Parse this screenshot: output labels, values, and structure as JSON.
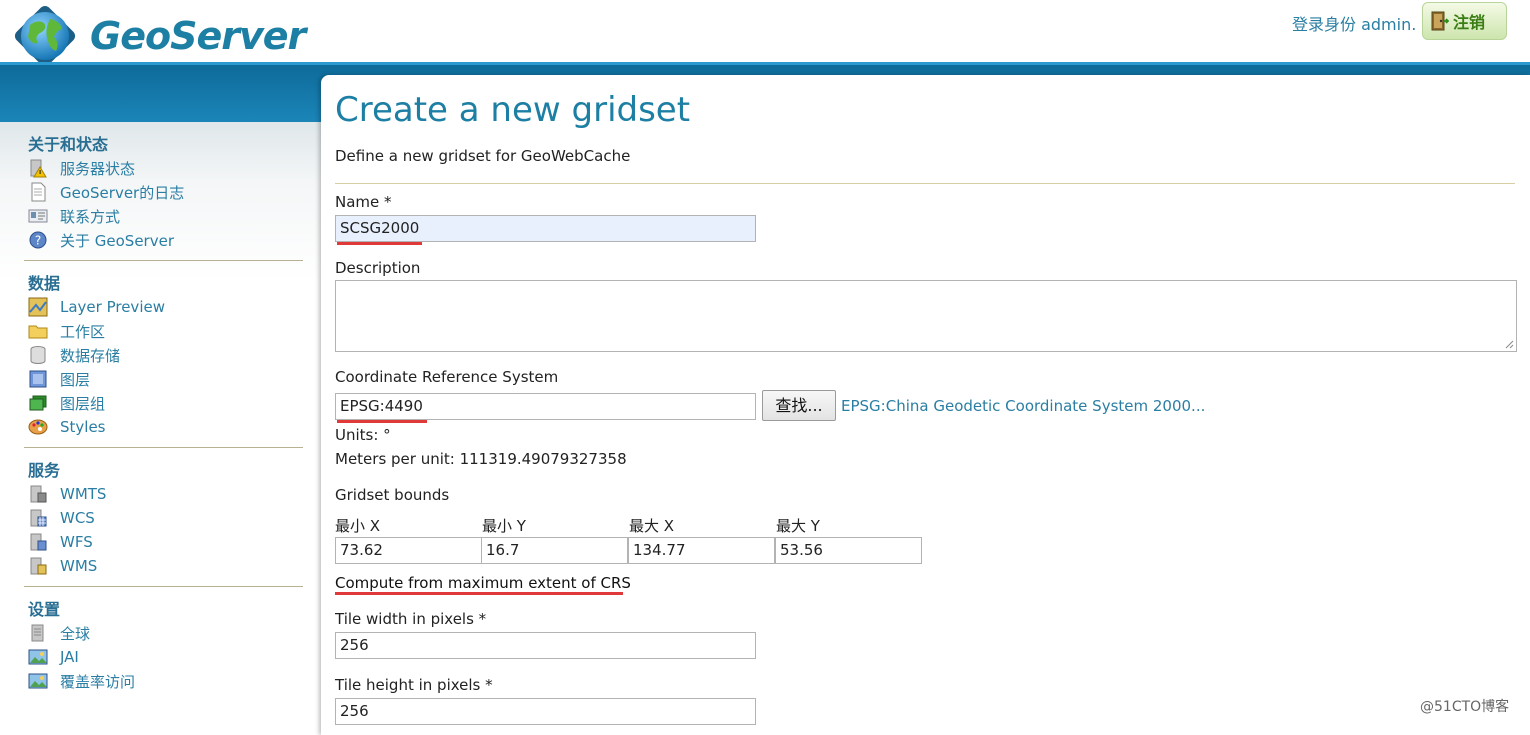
{
  "header": {
    "brand": "GeoServer",
    "login_info": "登录身份 admin.",
    "logout_label": "注销"
  },
  "sidebar": {
    "sections": [
      {
        "title": "关于和状态",
        "items": [
          "服务器状态",
          "GeoServer的日志",
          "联系方式",
          "关于 GeoServer"
        ]
      },
      {
        "title": "数据",
        "items": [
          "Layer Preview",
          "工作区",
          "数据存储",
          "图层",
          "图层组",
          "Styles"
        ]
      },
      {
        "title": "服务",
        "items": [
          "WMTS",
          "WCS",
          "WFS",
          "WMS"
        ]
      },
      {
        "title": "设置",
        "items": [
          "全球",
          "JAI",
          "覆盖率访问"
        ]
      }
    ]
  },
  "main": {
    "title": "Create a new gridset",
    "description": "Define a new gridset for GeoWebCache",
    "name_label": "Name *",
    "name_value": "SCSG2000",
    "description_label": "Description",
    "description_value": "",
    "crs_label": "Coordinate Reference System",
    "crs_value": "EPSG:4490",
    "find_button": "查找...",
    "crs_link": "EPSG:China Geodetic Coordinate System 2000...",
    "units": "Units: °",
    "meters_per_unit": "Meters per unit: 111319.49079327358",
    "bounds_label": "Gridset bounds",
    "bounds": {
      "headers": [
        "最小 X",
        "最小 Y",
        "最大 X",
        "最大 Y"
      ],
      "values": [
        "73.62",
        "16.7",
        "134.77",
        "53.56"
      ]
    },
    "compute_link": "Compute from maximum extent of CRS",
    "tile_width_label": "Tile width in pixels *",
    "tile_width_value": "256",
    "tile_height_label": "Tile height in pixels *",
    "tile_height_value": "256"
  },
  "watermark": "@51CTO博客",
  "colors": {
    "brand_blue": "#1d7fa3",
    "link_blue": "#2a7ea3",
    "annotation_red": "#e0393a"
  }
}
